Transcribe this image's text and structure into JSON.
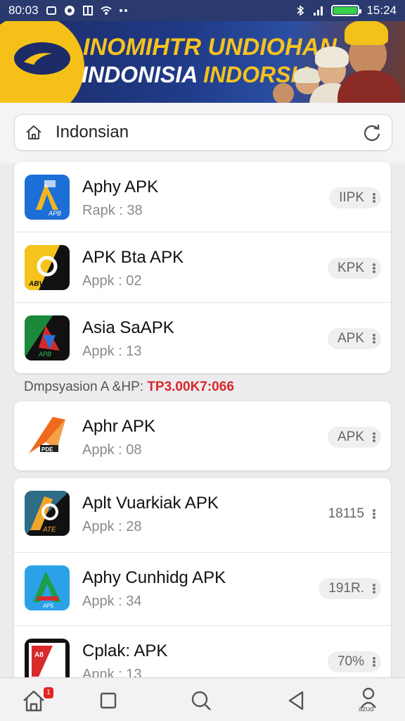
{
  "status_bar": {
    "time_left": "80:03",
    "time_right": "15:24",
    "colors": {
      "battery": "#37d04a"
    }
  },
  "banner": {
    "line1": "INOMIHTR UNDIOHAN",
    "line2_a": "INDONISIA",
    "line2_b": "INDORSIA"
  },
  "search": {
    "value": "Indonsian",
    "icons": [
      "home-icon",
      "refresh-icon"
    ]
  },
  "list_top": [
    {
      "name": "Aphy APK",
      "sub": "Rapk : 38",
      "pill": "IIPK",
      "icon_colors": [
        "#1d6fd8",
        "#f1b51d"
      ]
    },
    {
      "name": "APK Bta APK",
      "sub": "Appk : 02",
      "pill": "KPK",
      "icon_colors": [
        "#f5c31a",
        "#111111"
      ]
    },
    {
      "name": "Asia SaAPK",
      "sub": "Appk : 13",
      "pill": "APK",
      "icon_colors": [
        "#1a8a3a",
        "#d42a2a"
      ]
    }
  ],
  "section_label": {
    "text": "Dmpsyasion A &HP:",
    "highlight": "TP3.00K7:066",
    "color": "#d9262b"
  },
  "list_single": [
    {
      "name": "Aphr APK",
      "sub": "Appk : 08",
      "pill": "APK",
      "icon_colors": [
        "#ffffff",
        "#f06a1e"
      ]
    }
  ],
  "list_bottom": [
    {
      "name": "Aplt Vuarkiak APK",
      "sub": "Appk : 28",
      "pill": "18115",
      "icon_colors": [
        "#2f6d86",
        "#f2a629"
      ]
    },
    {
      "name": "Aphy Cunhidg APK",
      "sub": "Appk : 34",
      "pill": "191R.",
      "icon_colors": [
        "#2ba2e8",
        "#1e9e4a"
      ]
    },
    {
      "name": "Cplak: APK",
      "sub": "Apnk : 13",
      "pill": "70%",
      "icon_colors": [
        "#111111",
        "#d82a2a"
      ]
    }
  ],
  "bottom_nav": {
    "badge": "1",
    "profile_caption": "azud",
    "icons": [
      "home-icon",
      "square-icon",
      "search-icon",
      "back-icon",
      "profile-icon"
    ]
  }
}
